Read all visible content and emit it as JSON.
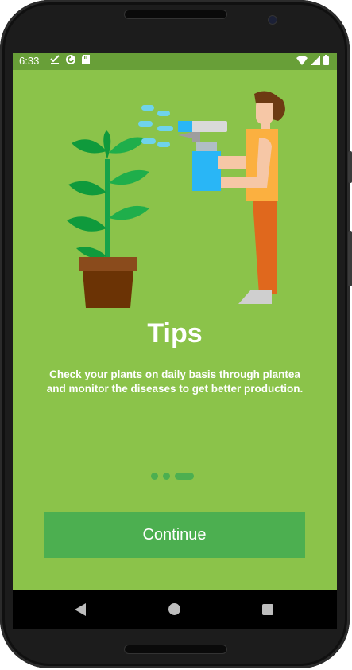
{
  "status_bar": {
    "time": "6:33",
    "left_icons": [
      "check-download-icon",
      "sync-icon",
      "sd-card-icon"
    ],
    "right_icons": [
      "wifi-icon",
      "signal-icon",
      "battery-icon"
    ]
  },
  "onboarding": {
    "title": "Tips",
    "description": "Check your plants on daily basis through plantea and monitor the diseases to get better production.",
    "illustration": "person-spraying-plant-illustration",
    "page_indicator": {
      "total": 3,
      "active_index": 2
    },
    "continue_label": "Continue"
  },
  "nav_bar": {
    "buttons": [
      "back-icon",
      "home-icon",
      "recents-icon"
    ]
  },
  "colors": {
    "background": "#8bc34a",
    "status_bar": "#689f38",
    "accent": "#4caf50",
    "text": "#ffffff"
  }
}
